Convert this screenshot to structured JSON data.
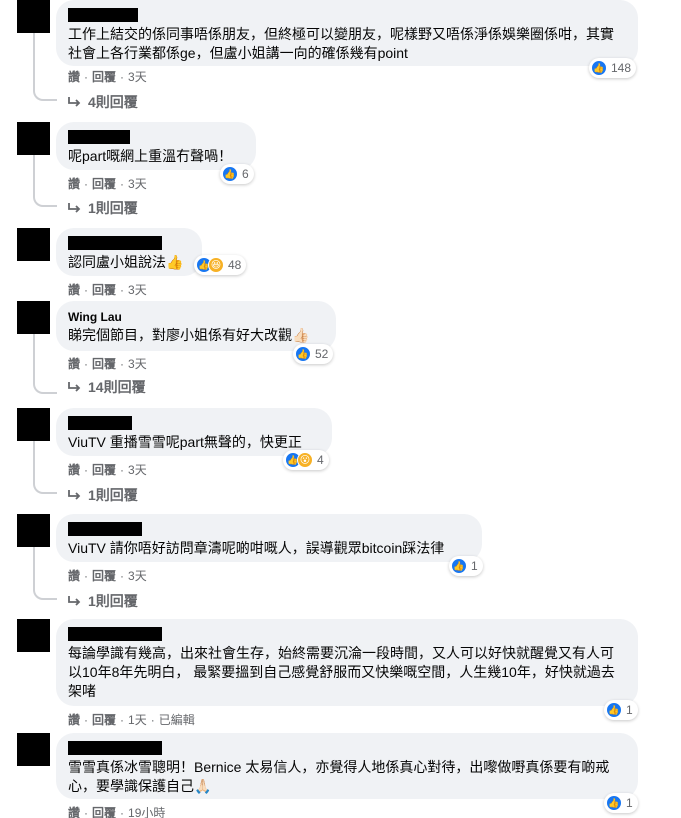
{
  "ui": {
    "like_label": "讚",
    "reply_label": "回覆",
    "separator": "·"
  },
  "comments": [
    {
      "author_hidden": true,
      "text": "工作上結交的係同事唔係朋友，但終極可以變朋友，呢樣野又唔係淨係娛樂圈係咁，其實社會上各行業都係ge，但盧小姐講一向的確係幾有point",
      "time": "3天",
      "reaction_count": "148",
      "reactions": [
        "like"
      ],
      "replies": "4則回覆"
    },
    {
      "author_hidden": true,
      "text": "呢part嘅網上重溫冇聲喎！",
      "time": "3天",
      "reaction_count": "6",
      "reactions": [
        "like"
      ],
      "replies": "1則回覆"
    },
    {
      "author_hidden": true,
      "text": "認同盧小姐說法👍",
      "time": "3天",
      "reaction_count": "48",
      "reactions": [
        "like",
        "haha"
      ],
      "replies": ""
    },
    {
      "author": "Wing Lau",
      "text": "睇完個節目，對廖小姐係有好大改觀👍🏻",
      "time": "3天",
      "reaction_count": "52",
      "reactions": [
        "like"
      ],
      "replies": "14則回覆"
    },
    {
      "author_hidden": true,
      "text": "ViuTV 重播雪雪呢part無聲的，快更正",
      "time": "3天",
      "reaction_count": "4",
      "reactions": [
        "like",
        "wow"
      ],
      "replies": "1則回覆"
    },
    {
      "author_hidden": true,
      "text": "ViuTV 請你唔好訪問章濤呢啲咁嘅人，誤導觀眾bitcoin踩法律",
      "time": "3天",
      "reaction_count": "1",
      "reactions": [
        "like"
      ],
      "replies": "1則回覆"
    },
    {
      "author_hidden": true,
      "text": "每論學識有幾高，出來社會生存，始終需要沉淪一段時間，又人可以好快就醒覺又有人可以10年8年先明白， 最緊要搵到自己感覺舒服而又快樂嘅空間，人生幾10年，好快就過去架啫",
      "time": "1天",
      "edited": "已編輯",
      "reaction_count": "1",
      "reactions": [
        "like"
      ],
      "replies": ""
    },
    {
      "author_hidden": true,
      "text": "雪雪真係冰雪聰明！Bernice 太易信人，亦覺得人地係真心對待，出嚟做嘢真係要有啲戒心，要學識保護自己🙏🏻",
      "time": "19小時",
      "reaction_count": "1",
      "reactions": [
        "like"
      ],
      "replies": ""
    }
  ]
}
